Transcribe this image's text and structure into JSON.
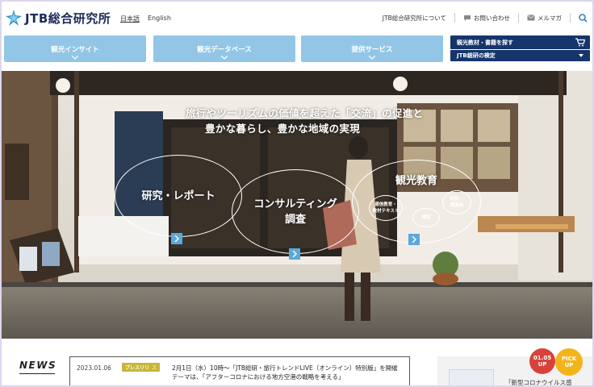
{
  "header": {
    "logo_text": "JTB総合研究所",
    "lang_ja": "日本語",
    "lang_en": "English",
    "about_link": "JTB総合研究所について",
    "contact_link": "お問い合わせ",
    "mailmag_link": "メルマガ"
  },
  "nav": {
    "items": [
      {
        "label": "観光インサイト"
      },
      {
        "label": "観光データベース"
      },
      {
        "label": "提供サービス"
      }
    ],
    "shop_label": "観光教材・書籍を探す",
    "exam_label": "JTB総研の検定"
  },
  "hero": {
    "tagline_line1": "旅行やツーリズムの価値を超えた「交流」の促進と",
    "tagline_line2": "豊かな暮らし、豊かな地域の実現",
    "circle1": "研究・レポート",
    "circle2_line1": "コンサルティング",
    "circle2_line2": "調査",
    "circle3": "観光教育",
    "mini1_line1": "通信教育・",
    "mini1_line2": "教材テキスト",
    "mini2": "検定",
    "mini3_line1": "研修・",
    "mini3_line2": "講演会"
  },
  "news": {
    "title": "NEWS",
    "date": "2023.01.06",
    "badge": "プレスリリ",
    "badge_close": "ス",
    "text_line1": "2月1日（水）10時～「JTB総研・旅行トレンドLIVE（オンライン）特別版」を開催",
    "text_line2": "テーマは、「アフターコロナにおける地方空港の戦略を考える」"
  },
  "pickup": {
    "date_badge_line1": "01.05",
    "date_badge_line2": "UP",
    "pick_line1": "PICK",
    "pick_line2": "UP",
    "text": "「新型コロナウイルス感"
  },
  "colors": {
    "nav_blue": "#93c6e6",
    "navy": "#16356c",
    "badge_olive": "#c8b63a",
    "arrow_blue": "#5aa9d9",
    "pickup_red": "#d9423b",
    "pickup_yellow": "#f2b519"
  }
}
